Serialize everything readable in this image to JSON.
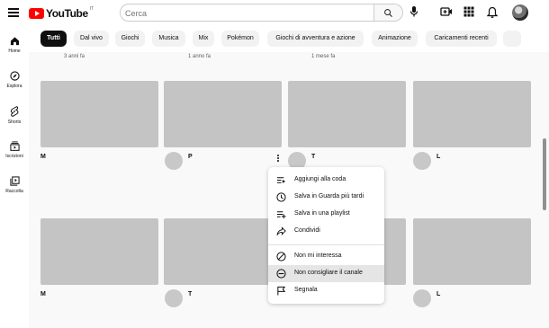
{
  "header": {
    "logo_text": "YouTube",
    "country_code": "IT",
    "search_placeholder": "Cerca"
  },
  "sidebar": {
    "items": [
      {
        "label": "Home",
        "icon": "home-icon"
      },
      {
        "label": "Esplora",
        "icon": "compass-icon"
      },
      {
        "label": "Shorts",
        "icon": "shorts-icon"
      },
      {
        "label": "Iscrizioni",
        "icon": "subscriptions-icon"
      },
      {
        "label": "Raccolta",
        "icon": "library-icon"
      }
    ]
  },
  "chips": [
    {
      "label": "Tutti",
      "active": true
    },
    {
      "label": "Dal vivo"
    },
    {
      "label": "Giochi"
    },
    {
      "label": "Musica"
    },
    {
      "label": "Mix"
    },
    {
      "label": "Pokémon"
    },
    {
      "label": "Giochi di avventura e azione"
    },
    {
      "label": "Animazione"
    },
    {
      "label": "Caricamenti recenti"
    }
  ],
  "top_row_meta": [
    "3 anni fa",
    "1 anno fa",
    "1 mese fa"
  ],
  "videos_row1": [
    {
      "title": "M"
    },
    {
      "title": "P"
    },
    {
      "title": "T"
    },
    {
      "title": "L"
    }
  ],
  "videos_row2": [
    {
      "title": "M"
    },
    {
      "title": "T"
    },
    {
      "title": ""
    },
    {
      "title": "L"
    }
  ],
  "menu": {
    "items": [
      {
        "label": "Aggiungi alla coda",
        "icon": "add-to-queue-icon"
      },
      {
        "label": "Salva in Guarda più tardi",
        "icon": "clock-icon"
      },
      {
        "label": "Salva in una playlist",
        "icon": "playlist-add-icon"
      },
      {
        "label": "Condividi",
        "icon": "share-icon"
      },
      {
        "label": "Non mi interessa",
        "icon": "not-interested-icon"
      },
      {
        "label": "Non consigliare il canale",
        "icon": "block-channel-icon",
        "hovered": true
      },
      {
        "label": "Segnala",
        "icon": "flag-icon"
      }
    ]
  },
  "colors": {
    "brand_red": "#ff0000",
    "thumb_placeholder": "#c4c4c4",
    "chip_active": "#0f0f0f",
    "chip_bg": "#f2f2f2",
    "menu_hover": "#e5e5e5"
  }
}
